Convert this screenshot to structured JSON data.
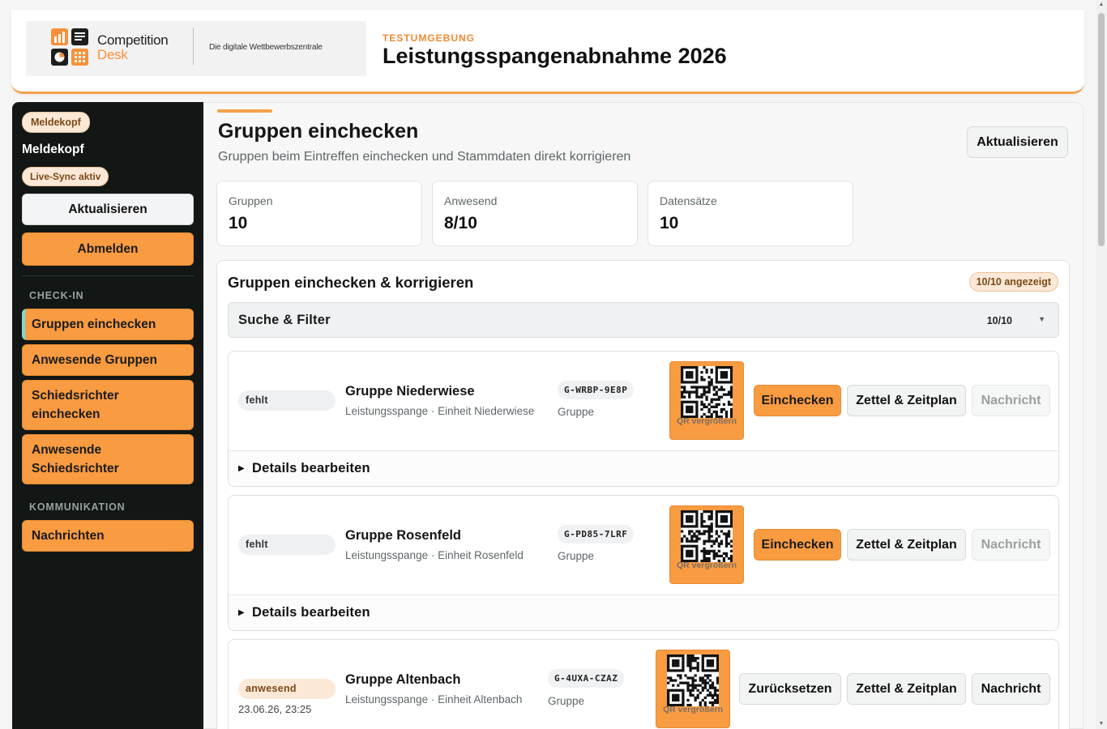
{
  "header": {
    "logo_line1": "Competition",
    "logo_line2": "Desk",
    "logo_tagline": "Die digitale Wettbewerbszentrale",
    "environment": "TESTUMGEBUNG",
    "event_title": "Leistungsspangenabnahme 2026"
  },
  "sidebar": {
    "role_pill": "Meldekopf",
    "user_name": "Meldekopf",
    "sync_pill": "Live-Sync aktiv",
    "refresh_label": "Aktualisieren",
    "logout_label": "Abmelden",
    "sections": [
      {
        "title": "CHECK-IN",
        "items": [
          "Gruppen einchecken",
          "Anwesende Gruppen",
          "Schiedsrichter einchecken",
          "Anwesende Schiedsrichter"
        ]
      },
      {
        "title": "KOMMUNIKATION",
        "items": [
          "Nachrichten"
        ]
      }
    ],
    "active_item": "Gruppen einchecken"
  },
  "main": {
    "title": "Gruppen einchecken",
    "subtitle": "Gruppen beim Eintreffen einchecken und Stammdaten direkt korrigieren",
    "refresh_label": "Aktualisieren",
    "stats": [
      {
        "label": "Gruppen",
        "value": "10"
      },
      {
        "label": "Anwesend",
        "value": "8/10"
      },
      {
        "label": "Datensätze",
        "value": "10"
      }
    ],
    "panel": {
      "title": "Gruppen einchecken & korrigieren",
      "count_pill": "10/10 angezeigt",
      "filter_label": "Suche & Filter",
      "filter_count": "10/10",
      "details_label": "Details bearbeiten",
      "qr_label": "QR vergrößern",
      "code_sub": "Gruppe",
      "groups": [
        {
          "status": "fehlt",
          "timestamp": "",
          "name": "Gruppe Niederwiese",
          "sub": "Leistungsspange · Einheit Niederwiese",
          "code": "G-WRBP-9E8P",
          "actions": [
            "Einchecken",
            "Zettel & Zeitplan",
            "Nachricht"
          ]
        },
        {
          "status": "fehlt",
          "timestamp": "",
          "name": "Gruppe Rosenfeld",
          "sub": "Leistungsspange · Einheit Rosenfeld",
          "code": "G-PD85-7LRF",
          "actions": [
            "Einchecken",
            "Zettel & Zeitplan",
            "Nachricht"
          ]
        },
        {
          "status": "anwesend",
          "timestamp": "23.06.26, 23:25",
          "name": "Gruppe Altenbach",
          "sub": "Leistungsspange · Einheit Altenbach",
          "code": "G-4UXA-CZAZ",
          "actions": [
            "Zurücksetzen",
            "Zettel & Zeitplan",
            "Nachricht"
          ]
        }
      ]
    }
  },
  "colors": {
    "accent": "#f89b41",
    "sidebar_bg": "#121716",
    "active_marker": "#7fd8d0"
  },
  "icons": [
    "competition-desk-logo",
    "qr-code-icon",
    "disclosure-triangle-icon",
    "chevron-down-icon"
  ]
}
